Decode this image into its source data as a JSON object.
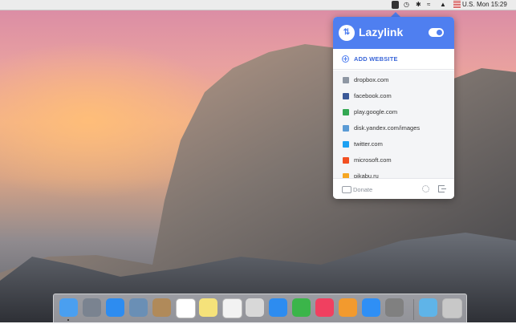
{
  "menubar": {
    "locale": "U.S.",
    "time": "Mon 15:29"
  },
  "popover": {
    "app_name": "Lazylink",
    "toggle_on": true,
    "add_website_label": "ADD WEBSITE",
    "sites": [
      {
        "label": "dropbox.com",
        "icon": "dropbox-icon",
        "color": "#8e97a3"
      },
      {
        "label": "facebook.com",
        "icon": "facebook-icon",
        "color": "#3b5998"
      },
      {
        "label": "play.google.com",
        "icon": "google-play-icon",
        "color": "#34a853"
      },
      {
        "label": "disk.yandex.com/images",
        "icon": "yandex-disk-icon",
        "color": "#5b9bd5"
      },
      {
        "label": "twitter.com",
        "icon": "twitter-icon",
        "color": "#1da1f2"
      },
      {
        "label": "microsoft.com",
        "icon": "microsoft-icon",
        "color": "#f25022"
      },
      {
        "label": "pikabu.ru",
        "icon": "pikabu-icon",
        "color": "#f5a623"
      }
    ],
    "donate_label": "Donate"
  },
  "colors": {
    "accent": "#4f7ff0",
    "menubar": "#ececec"
  },
  "dock": {
    "apps": [
      {
        "name": "finder",
        "color": "#4a9ff0"
      },
      {
        "name": "launchpad",
        "color": "#7a8390"
      },
      {
        "name": "safari",
        "color": "#2d8cf0"
      },
      {
        "name": "mail",
        "color": "#6a8fb5"
      },
      {
        "name": "contacts",
        "color": "#b08a5a"
      },
      {
        "name": "calendar",
        "color": "#ffffff"
      },
      {
        "name": "notes",
        "color": "#f5e27a"
      },
      {
        "name": "reminders",
        "color": "#f2f2f2"
      },
      {
        "name": "photos-preview",
        "color": "#d8d8d8"
      },
      {
        "name": "messages",
        "color": "#2d8cf0"
      },
      {
        "name": "facetime",
        "color": "#3bb54a"
      },
      {
        "name": "itunes",
        "color": "#f04060"
      },
      {
        "name": "ibooks",
        "color": "#f29a2e"
      },
      {
        "name": "app-store",
        "color": "#2f8ff5"
      },
      {
        "name": "system-preferences",
        "color": "#808080"
      },
      {
        "name": "downloads",
        "color": "#5fb4e8"
      },
      {
        "name": "trash",
        "color": "#c8c8c8"
      }
    ]
  }
}
